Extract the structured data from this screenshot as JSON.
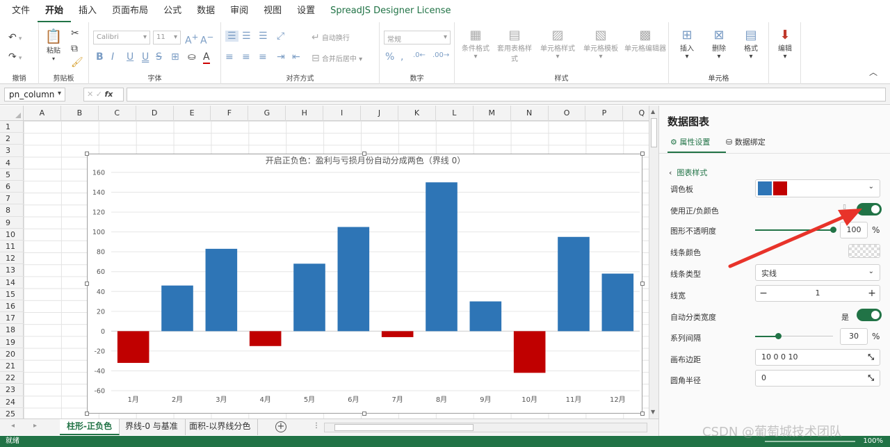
{
  "menu": [
    "文件",
    "开始",
    "插入",
    "页面布局",
    "公式",
    "数据",
    "审阅",
    "视图",
    "设置",
    "SpreadJS Designer License"
  ],
  "ribbon": {
    "undo_group": "撤销",
    "clipboard": {
      "paste": "粘贴",
      "label": "剪贴板"
    },
    "font": {
      "name": "Calibri",
      "size": "11",
      "label": "字体"
    },
    "align": {
      "wrap": "自动换行",
      "merge": "合并后居中",
      "label": "对齐方式"
    },
    "number": {
      "format": "常规",
      "label": "数字"
    },
    "styles": {
      "conditional": "条件格式",
      "table": "套用表格样式",
      "cell": "单元格样式",
      "template": "单元格模板",
      "editor": "单元格编辑器",
      "label": "样式"
    },
    "cells": {
      "insert": "插入",
      "delete": "删除",
      "format": "格式",
      "label": "单元格"
    },
    "edit": "编辑"
  },
  "formula_bar": {
    "name_box": "pn_column",
    "fx": "fx",
    "value": ""
  },
  "sheet": {
    "columns": [
      "A",
      "B",
      "C",
      "D",
      "E",
      "F",
      "G",
      "H",
      "I",
      "J",
      "K",
      "L",
      "M",
      "N",
      "O",
      "P",
      "Q"
    ],
    "rows": [
      "1",
      "2",
      "3",
      "4",
      "5",
      "6",
      "7",
      "8",
      "9",
      "10",
      "11",
      "12",
      "13",
      "14",
      "15",
      "16",
      "17",
      "18",
      "19",
      "20",
      "21",
      "22",
      "23",
      "24",
      "25"
    ]
  },
  "chart_data": {
    "type": "bar",
    "title": "开启正负色：盈利与亏损月份自动分成两色（界线 0）",
    "categories": [
      "1月",
      "2月",
      "3月",
      "4月",
      "5月",
      "6月",
      "7月",
      "8月",
      "9月",
      "10月",
      "11月",
      "12月"
    ],
    "values": [
      -32,
      46,
      83,
      -15,
      68,
      105,
      -6,
      150,
      30,
      -42,
      95,
      58
    ],
    "ylim": [
      -60,
      160
    ],
    "yticks": [
      -60,
      -40,
      -20,
      0,
      20,
      40,
      60,
      80,
      100,
      120,
      140,
      160
    ],
    "xlabel": "",
    "ylabel": "",
    "positive_color": "#2e75b6",
    "negative_color": "#c00000",
    "grid": true,
    "legend": "none"
  },
  "tabs": [
    "柱形-正负色",
    "界线-0 与基准",
    "面积-以界线分色"
  ],
  "status": {
    "text": "就绪",
    "zoom": "100%"
  },
  "panel": {
    "title": "数据图表",
    "tab_props": "属性设置",
    "tab_binding": "数据绑定",
    "section": "图表样式",
    "palette_label": "调色板",
    "palette_colors": [
      "#2e75b6",
      "#c00000"
    ],
    "use_posneg_label": "使用正/负颜色",
    "opacity_label": "图形不透明度",
    "opacity_value": "100",
    "opacity_unit": "%",
    "line_color_label": "线条颜色",
    "line_type_label": "线条类型",
    "line_type_value": "实线",
    "line_width_label": "线宽",
    "line_width_value": "1",
    "auto_width_label": "自动分类宽度",
    "auto_width_value": "是",
    "series_gap_label": "系列间隔",
    "series_gap_value": "30",
    "series_gap_unit": "%",
    "padding_label": "画布边距",
    "padding_value": "10 0 0 10",
    "radius_label": "圆角半径",
    "radius_value": "0"
  },
  "watermark": "CSDN @葡萄城技术团队"
}
